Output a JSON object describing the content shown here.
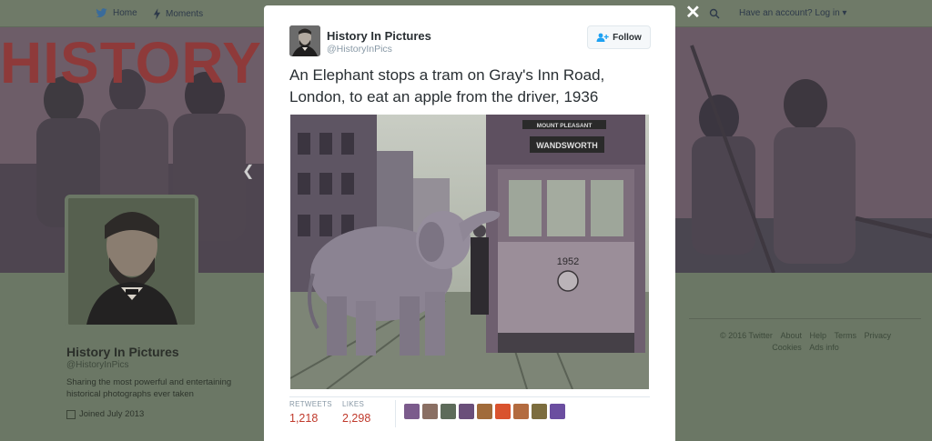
{
  "topnav": {
    "home_label": "Home",
    "moments_label": "Moments",
    "account_prompt": "Have an account? Log in ▾"
  },
  "banner": {
    "title_text": "HISTORYINP"
  },
  "profile": {
    "name": "History In Pictures",
    "handle": "@HistoryInPics",
    "bio": "Sharing the most powerful and entertaining historical photographs ever taken",
    "joined": "Joined July 2013"
  },
  "footer": {
    "links": [
      "© 2016 Twitter",
      "About",
      "Help",
      "Terms",
      "Privacy",
      "Cookies",
      "Ads info"
    ]
  },
  "modal": {
    "close_label": "✕",
    "author_name": "History In Pictures",
    "author_handle": "@HistoryInPics",
    "follow_label": "Follow",
    "tweet_text": "An Elephant stops a tram on Gray's Inn Road, London, to eat an apple from the driver, 1936",
    "photo": {
      "tram_sign_top": "MOUNT PLEASANT",
      "tram_sign_dest": "WANDSWORTH",
      "tram_number": "1952"
    },
    "stats": {
      "retweets_label": "RETWEETS",
      "retweets_value": "1,218",
      "likes_label": "LIKES",
      "likes_value": "2,298"
    },
    "liker_colors": [
      "#7b5b8c",
      "#8a6f63",
      "#5d6b5a",
      "#6a4f7a",
      "#a16b3a",
      "#d9532e",
      "#b36b3f",
      "#7c6d3e",
      "#6b4ea0"
    ]
  },
  "colors": {
    "accent_stat": "#c0392b",
    "handle_gray": "#8899a6",
    "text_dark": "#292f33"
  }
}
